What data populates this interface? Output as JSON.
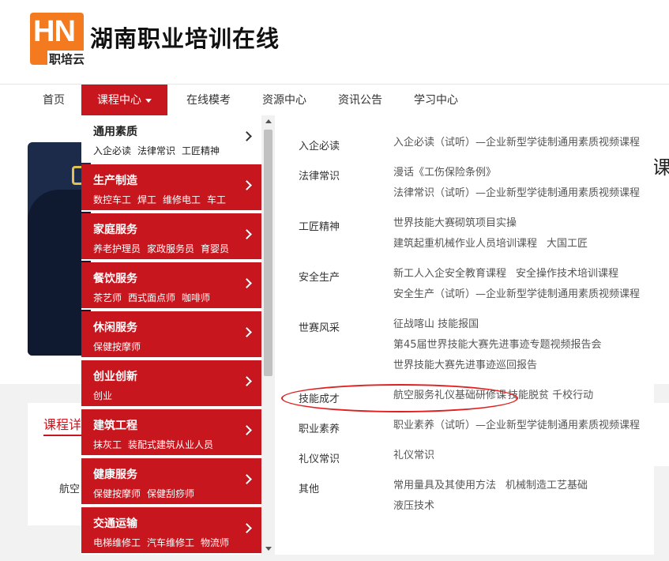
{
  "brand": {
    "logo_letters": "HN",
    "logo_sub": "职培云",
    "site_title": "湖南职业培训在线"
  },
  "nav": {
    "items": [
      "首页",
      "课程中心",
      "在线模考",
      "资源中心",
      "资讯公告",
      "学习中心"
    ],
    "active": "课程中心"
  },
  "background": {
    "card_title": "课程详",
    "card_text": "航空",
    "edge_char": "课"
  },
  "categories": [
    {
      "title": "通用素质",
      "subs": [
        "入企必读",
        "法律常识",
        "工匠精神"
      ]
    },
    {
      "title": "生产制造",
      "subs": [
        "数控车工",
        "焊工",
        "维修电工",
        "车工"
      ]
    },
    {
      "title": "家庭服务",
      "subs": [
        "养老护理员",
        "家政服务员",
        "育婴员"
      ]
    },
    {
      "title": "餐饮服务",
      "subs": [
        "茶艺师",
        "西式面点师",
        "咖啡师"
      ]
    },
    {
      "title": "休闲服务",
      "subs": [
        "保健按摩师"
      ]
    },
    {
      "title": "创业创新",
      "subs": [
        "创业"
      ]
    },
    {
      "title": "建筑工程",
      "subs": [
        "抹灰工",
        "装配式建筑从业人员"
      ]
    },
    {
      "title": "健康服务",
      "subs": [
        "保健按摩师",
        "保健刮痧师"
      ]
    },
    {
      "title": "交通运输",
      "subs": [
        "电梯维修工",
        "汽车维修工",
        "物流师"
      ]
    }
  ],
  "details": [
    {
      "label": "入企必读",
      "lines": [
        [
          "入企必读（试听）—企业新型学徒制通用素质视频课程"
        ]
      ]
    },
    {
      "label": "法律常识",
      "lines": [
        [
          "漫话《工伤保险条例》"
        ],
        [
          "法律常识（试听）—企业新型学徒制通用素质视频课程"
        ]
      ]
    },
    {
      "label": "工匠精神",
      "lines": [
        [
          "世界技能大赛砌筑项目实操"
        ],
        [
          "建筑起重机械作业人员培训课程",
          "大国工匠"
        ]
      ]
    },
    {
      "label": "安全生产",
      "lines": [
        [
          "新工人入企安全教育课程",
          "安全操作技术培训课程"
        ],
        [
          "安全生产（试听）—企业新型学徒制通用素质视频课程"
        ]
      ]
    },
    {
      "label": "世赛风采",
      "lines": [
        [
          "征战喀山 技能报国"
        ],
        [
          "第45届世界技能大赛先进事迹专题视频报告会"
        ],
        [
          "世界技能大赛先进事迹巡回报告"
        ]
      ]
    },
    {
      "label": "技能成才",
      "lines": [
        [
          "航空服务礼仪基础研修课",
          "技能脱贫 千校行动"
        ]
      ]
    },
    {
      "label": "职业素养",
      "lines": [
        [
          "职业素养（试听）—企业新型学徒制通用素质视频课程"
        ]
      ]
    },
    {
      "label": "礼仪常识",
      "lines": [
        [
          "礼仪常识"
        ]
      ]
    },
    {
      "label": "其他",
      "lines": [
        [
          "常用量具及其使用方法",
          "机械制造工艺基础"
        ],
        [
          "液压技术"
        ]
      ]
    }
  ],
  "colors": {
    "brand_red": "#c8161e",
    "logo_orange": "#f47a1f",
    "highlight_circle": "#e02020"
  }
}
